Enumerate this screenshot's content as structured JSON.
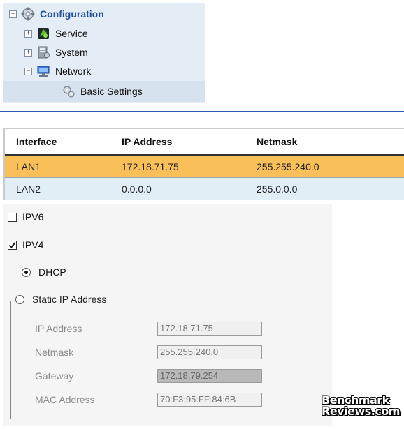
{
  "tree": {
    "root": {
      "label": "Configuration",
      "toggle": "−"
    },
    "items": [
      {
        "label": "Service",
        "toggle": "+"
      },
      {
        "label": "System",
        "toggle": "+"
      },
      {
        "label": "Network",
        "toggle": "−"
      }
    ],
    "selected": {
      "label": "Basic Settings"
    }
  },
  "table": {
    "headers": [
      "Interface",
      "IP Address",
      "Netmask"
    ],
    "rows": [
      [
        "LAN1",
        "172.18.71.75",
        "255.255.240.0"
      ],
      [
        "LAN2",
        "0.0.0.0",
        "255.0.0.0"
      ]
    ],
    "selected_row": 0
  },
  "ip": {
    "ipv6": {
      "label": "IPV6",
      "checked": false
    },
    "ipv4": {
      "label": "IPV4",
      "checked": true
    },
    "dhcp": {
      "label": "DHCP",
      "selected": true
    },
    "static": {
      "label": "Static IP Address",
      "selected": false
    },
    "fields": [
      {
        "label": "IP Address",
        "value": "172.18.71.75"
      },
      {
        "label": "Netmask",
        "value": "255.255.240.0"
      },
      {
        "label": "Gateway",
        "value": "172.18.79.254"
      },
      {
        "label": "MAC Address",
        "value": "70:F3:95:FF:84:6B"
      }
    ]
  },
  "watermark": {
    "line1": "Benchmark",
    "line2": "Reviews.com"
  },
  "colors": {
    "selected_row": "#f9c05a",
    "alt_row": "#e2eef5",
    "tree_bg": "#e4edf5",
    "divider": "#2c5db0"
  },
  "icons": [
    "gear-icon",
    "service-icon",
    "system-icon",
    "network-icon",
    "settings-gears-icon"
  ]
}
